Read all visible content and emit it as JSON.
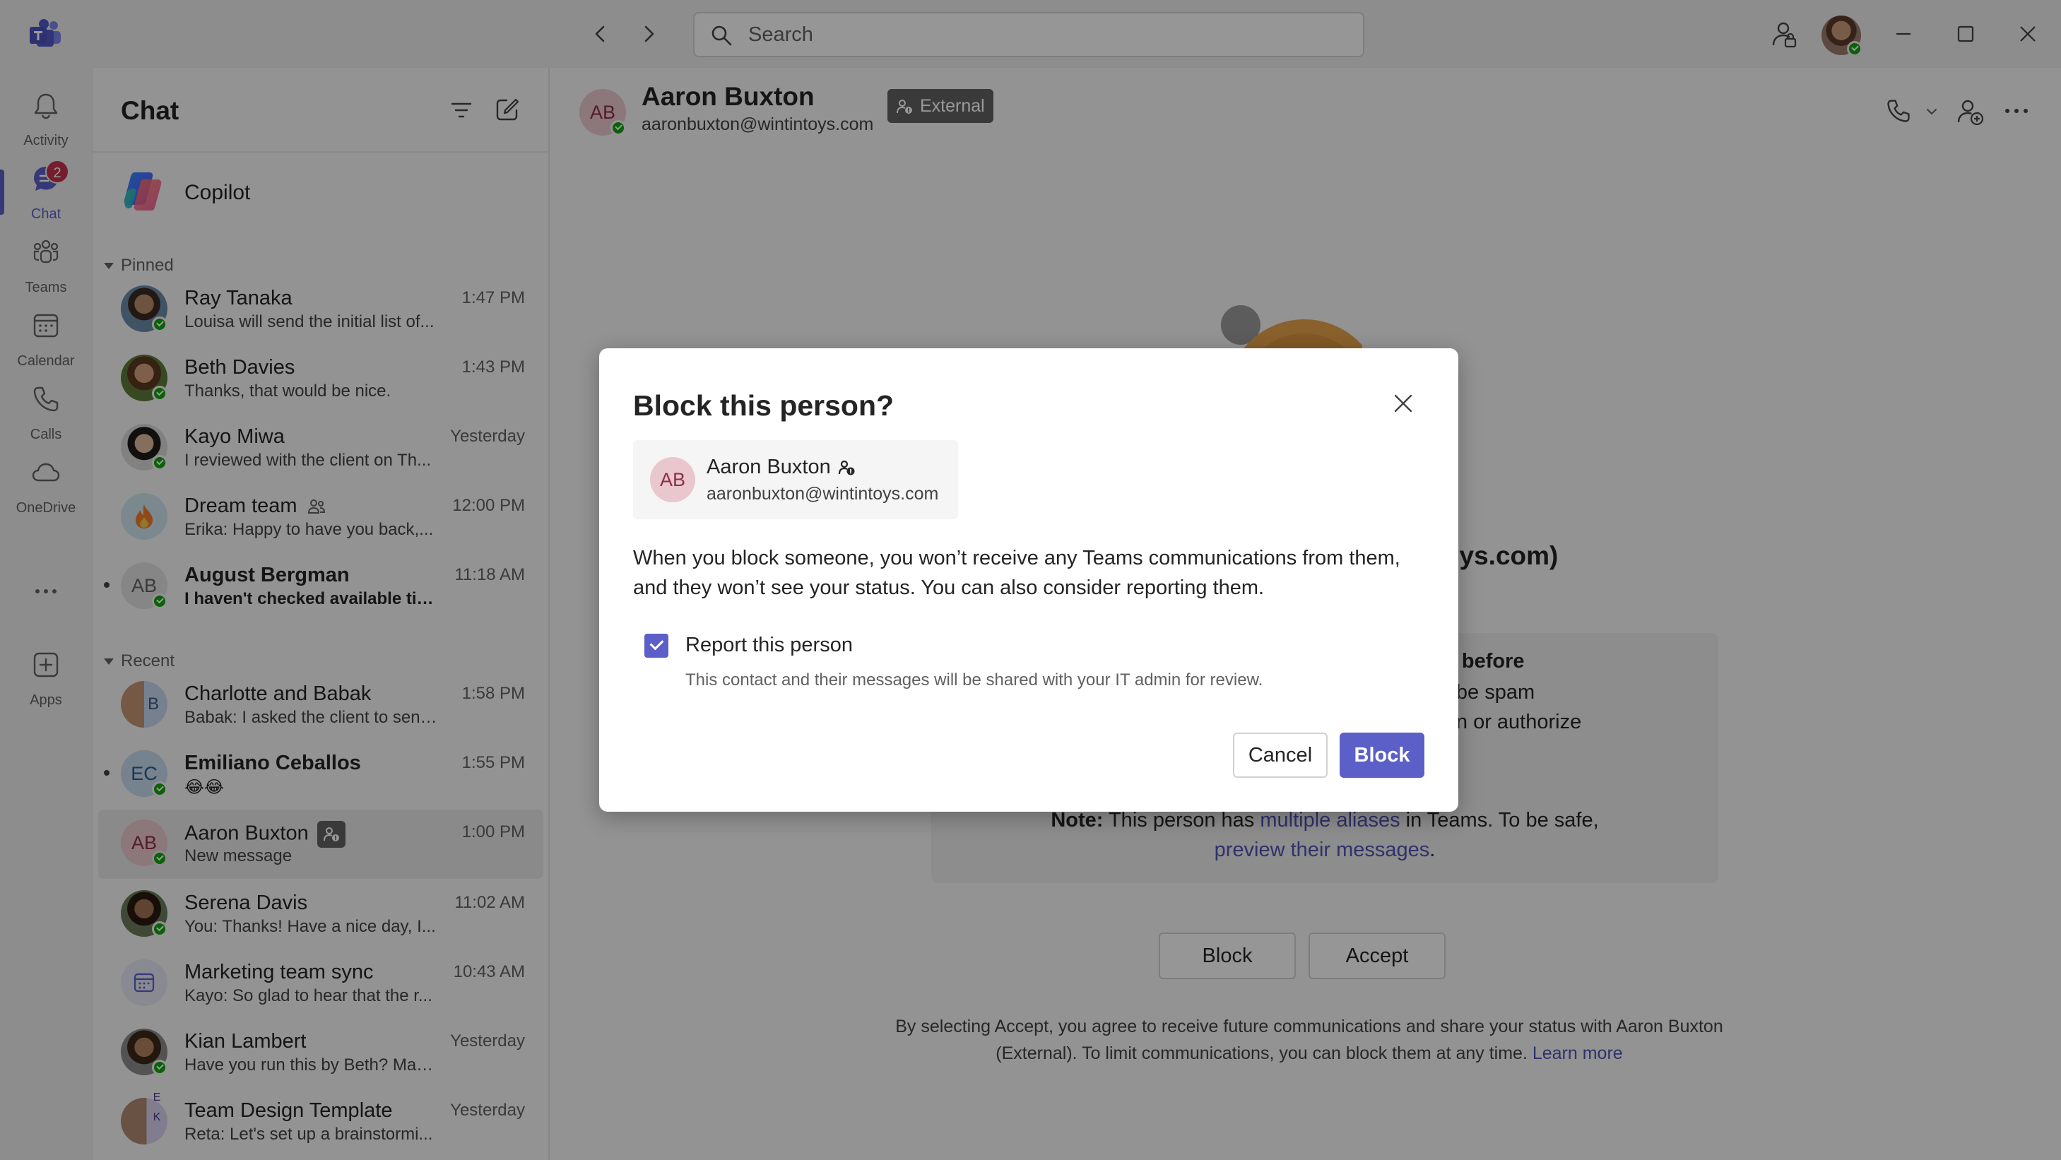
{
  "titlebar": {
    "search_placeholder": "Search"
  },
  "rail": {
    "items": [
      {
        "label": "Activity",
        "icon": "bell-icon"
      },
      {
        "label": "Chat",
        "icon": "chat-icon",
        "badge": "2",
        "active": true
      },
      {
        "label": "Teams",
        "icon": "teams-icon"
      },
      {
        "label": "Calendar",
        "icon": "calendar-icon"
      },
      {
        "label": "Calls",
        "icon": "phone-icon"
      },
      {
        "label": "OneDrive",
        "icon": "cloud-icon"
      },
      {
        "label": "Apps",
        "icon": "add-app-icon"
      }
    ]
  },
  "chatlist": {
    "title": "Chat",
    "copilot_label": "Copilot",
    "pinned_label": "Pinned",
    "recent_label": "Recent",
    "pinned": [
      {
        "name": "Ray Tanaka",
        "preview": "Louisa will send the initial list of...",
        "time": "1:47 PM"
      },
      {
        "name": "Beth Davies",
        "preview": "Thanks, that would be nice.",
        "time": "1:43 PM"
      },
      {
        "name": "Kayo Miwa",
        "preview": "I reviewed with the client on Th...",
        "time": "Yesterday"
      },
      {
        "name": "Dream team",
        "preview": "Erika: Happy to have you back,...",
        "time": "12:00 PM"
      },
      {
        "name": "August Bergman",
        "initials": "AB",
        "preview": "I haven't checked available tim...",
        "time": "11:18 AM"
      }
    ],
    "recent": [
      {
        "name": "Charlotte and Babak",
        "initials": "B",
        "preview": "Babak: I asked the client to send...",
        "time": "1:58 PM"
      },
      {
        "name": "Emiliano Ceballos",
        "initials": "EC",
        "preview": "😂😂",
        "time": "1:55 PM"
      },
      {
        "name": "Aaron Buxton",
        "initials": "AB",
        "preview": "New message",
        "time": "1:00 PM"
      },
      {
        "name": "Serena Davis",
        "preview": "You: Thanks! Have a nice day, I...",
        "time": "11:02 AM"
      },
      {
        "name": "Marketing team sync",
        "preview": "Kayo: So glad to hear that the r...",
        "time": "10:43 AM"
      },
      {
        "name": "Kian Lambert",
        "preview": "Have you run this by Beth? Mak...",
        "time": "Yesterday"
      },
      {
        "name": "Team Design Template",
        "initials": "E K",
        "preview": "Reta: Let's set up a brainstormi...",
        "time": "Yesterday"
      }
    ]
  },
  "main": {
    "header": {
      "initials": "AB",
      "name": "Aaron Buxton",
      "email": "aaronbuxton@wintintoys.com",
      "external_label": "External"
    },
    "heading_visible": "ntoys.com)",
    "warning": {
      "title_visible": "rson before",
      "line1_visible": "ould be spam",
      "line2_visible": "nation or authorize",
      "note_bold": "Note:",
      "note_text": " This person has ",
      "note_link1": "multiple aliases",
      "note_text2": " in Teams. To be safe,",
      "note_link2": "preview their messages",
      "note_end": "."
    },
    "block_label": "Block",
    "accept_label": "Accept",
    "footer_text": "By selecting Accept, you agree to receive future communications and share your status with Aaron Buxton (External). To limit communications, you can block them at any time. ",
    "footer_link": "Learn more"
  },
  "dialog": {
    "title": "Block this person?",
    "person": {
      "initials": "AB",
      "name": "Aaron Buxton",
      "email": "aaronbuxton@wintintoys.com"
    },
    "body": "When you block someone, you won’t receive any Teams communications from them, and they won’t see your status. You can also consider reporting them.",
    "report_label": "Report this person",
    "report_checked": true,
    "report_desc": "This contact and their messages will be shared with your IT admin for review.",
    "cancel_label": "Cancel",
    "block_label": "Block"
  },
  "colors": {
    "accent": "#5b5fc7",
    "presence_available": "#13a10e",
    "badge": "#c4314b",
    "external_badge": "#616161"
  }
}
